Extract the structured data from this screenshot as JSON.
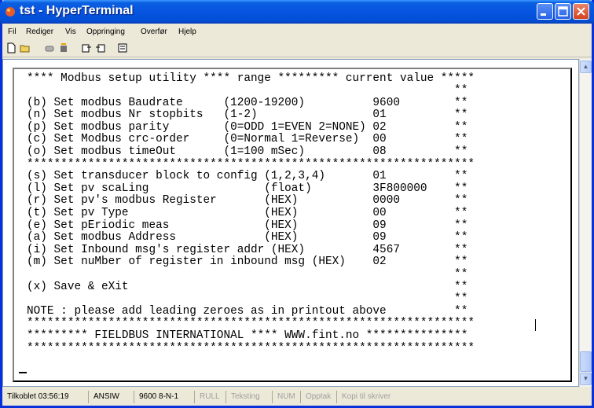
{
  "window": {
    "title": "tst - HyperTerminal"
  },
  "menu": [
    "Fil",
    "Rediger",
    "Vis",
    "Oppringing",
    "Overfør",
    "Hjelp"
  ],
  "toolbar": {
    "icons": [
      "new-icon",
      "open-icon",
      "connect-icon",
      "disconnect-icon",
      "send-icon",
      "receive-icon",
      "properties-icon"
    ]
  },
  "terminal": {
    "lines": [
      "**** Modbus setup utility **** range ********* current value *****",
      "                                                               **",
      "(b) Set modbus Baudrate      (1200-19200)          9600        **",
      "(n) Set modbus Nr stopbits   (1-2)                 01          **",
      "(p) Set modbus parity        (0=ODD 1=EVEN 2=NONE) 02          **",
      "(c) Set Modbus crc-order     (0=Normal 1=Reverse)  00          **",
      "(o) Set modbus timeOut       (1=100 mSec)          08          **",
      "******************************************************************",
      "(s) Set transducer block to config (1,2,3,4)       01          **",
      "(l) Set pv scaLing                 (float)         3F800000    **",
      "(r) Set pv's modbus Register       (HEX)           0000        **",
      "(t) Set pv Type                    (HEX)           00          **",
      "(e) Set pEriodic meas              (HEX)           09          **",
      "(a) Set modbus Address             (HEX)           09          **",
      "(i) Set Inbound msg's register addr (HEX)          4567        **",
      "(m) Set nuMber of register in inbound msg (HEX)    02          **",
      "                                                               **",
      "(x) Save & eXit                                                **",
      "                                                               **",
      "NOTE : please add leading zeroes as in printout above          **",
      "******************************************************************",
      "********* FIELDBUS INTERNATIONAL **** WWW.fint.no ***************",
      "******************************************************************"
    ]
  },
  "status": {
    "connected": "Tilkoblet 03:56:19",
    "emulation": "ANSIW",
    "settings": "9600 8-N-1",
    "scroll": "RULL",
    "capture": "Teksting",
    "num": "NUM",
    "record": "Opptak",
    "print": "Kopi til skriver"
  }
}
